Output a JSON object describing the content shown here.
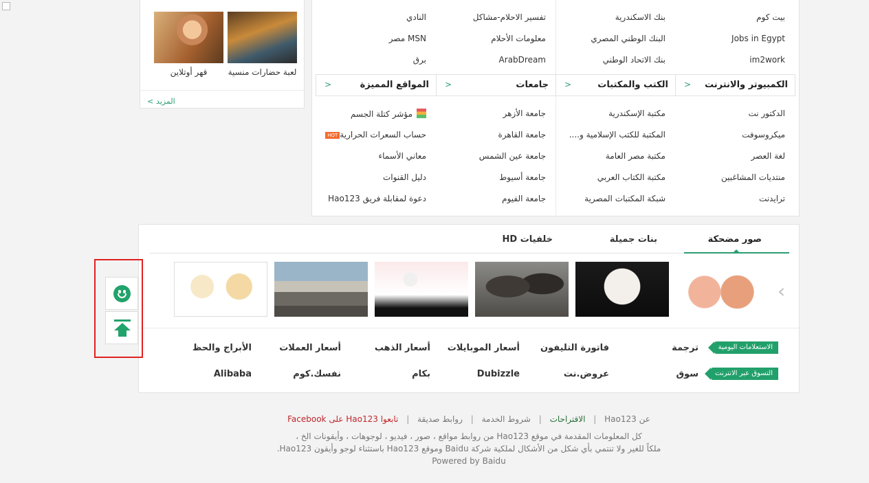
{
  "games": {
    "items": [
      {
        "caption": "لعبة حضارات منسية"
      },
      {
        "caption": "قهر أوتلاين"
      }
    ],
    "more_label": "المزيد"
  },
  "links_top": [
    [
      "بيت كوم",
      "بنك الاسكندرية",
      "تفسير الاحلام-مشاكل",
      "النادي"
    ],
    [
      "Jobs in Egypt",
      "البنك الوطني المصري",
      "معلومات الأحلام",
      "MSN مصر"
    ],
    [
      "im2work",
      "بنك الاتحاد الوطني",
      "ArabDream",
      "برق"
    ]
  ],
  "categories": [
    {
      "title": "الكمبيوتر والانترنت",
      "arrow": ">"
    },
    {
      "title": "الكتب والمكتبات",
      "arrow": ">"
    },
    {
      "title": "جامعات",
      "arrow": ">"
    },
    {
      "title": "المواقع المميزة",
      "arrow": ">"
    }
  ],
  "links_bottom": [
    [
      "الدكتور نت",
      "مكتبة الإسكندرية",
      "جامعة الأزهر",
      "مؤشر كتلة الجسم"
    ],
    [
      "ميكروسوفت",
      "المكتبة للكتب الإسلامية و....",
      "جامعة القاهرة",
      "حساب السعرات الحرارية"
    ],
    [
      "لغة العصر",
      "مكتبة مصر العامة",
      "جامعة عين الشمس",
      "معاني الأسماء"
    ],
    [
      "منتديات المشاغبين",
      "مكتبة الكتاب العربي",
      "جامعة أسيوط",
      "دليل القنوات"
    ],
    [
      "ترايدنت",
      "شبكة المكتبات المصرية",
      "جامعة الفيوم",
      "دعوة لمقابلة فريق Hao123"
    ]
  ],
  "hot_badge": "HOT",
  "photo_tabs": [
    "صور مضحكة",
    "بنات جميلة",
    "خلفيات HD"
  ],
  "photos": [
    {
      "icon": "funny-couple-cartoon"
    },
    {
      "icon": "alpaca-photo"
    },
    {
      "icon": "monkeys-photo"
    },
    {
      "icon": "meme-text-photo"
    },
    {
      "icon": "toyota-truck-photo"
    },
    {
      "icon": "office-cartoon"
    }
  ],
  "carousel_arrow": "‹",
  "services": {
    "row1_tag": "الاستعلامات اليومية",
    "row1": [
      "ترجمة",
      "فاتورة التليفون",
      "أسعار الموبايلات",
      "أسعار الذهب",
      "أسعار العملات",
      "الأبراج والحظ"
    ],
    "row2_tag": "التسوق عبر الانترنت",
    "row2": [
      "سوق",
      "عروض.نت",
      "Dubizzle",
      "بكام",
      "نفسك.كوم",
      "Alibaba"
    ]
  },
  "float_buttons": {
    "feedback_icon": "smile-icon",
    "top_icon": "back-to-top-icon"
  },
  "footer": {
    "links": [
      "عن Hao123",
      "الاقتراحات",
      "شروط الخدمة",
      "روابط صديقة",
      "تابعوا Hao123 على Facebook"
    ],
    "separator": "|",
    "line1": "كل المعلومات المقدمة في موقع Hao123 من روابط مواقع ، صور ، فيديو ، لوجوهات ، وأيقونات الخ ،",
    "line2": "ملكاً للغير ولا تنتمي بأي شكل من الأشكال لملكية شركة Baidu وموقع Hao123 باستثناء لوجو وأيقون Hao123.",
    "powered": "Powered by Baidu"
  },
  "colors": {
    "accent": "#22a06b",
    "highlight_box": "#e02020",
    "facebook_link": "#c0262c"
  }
}
